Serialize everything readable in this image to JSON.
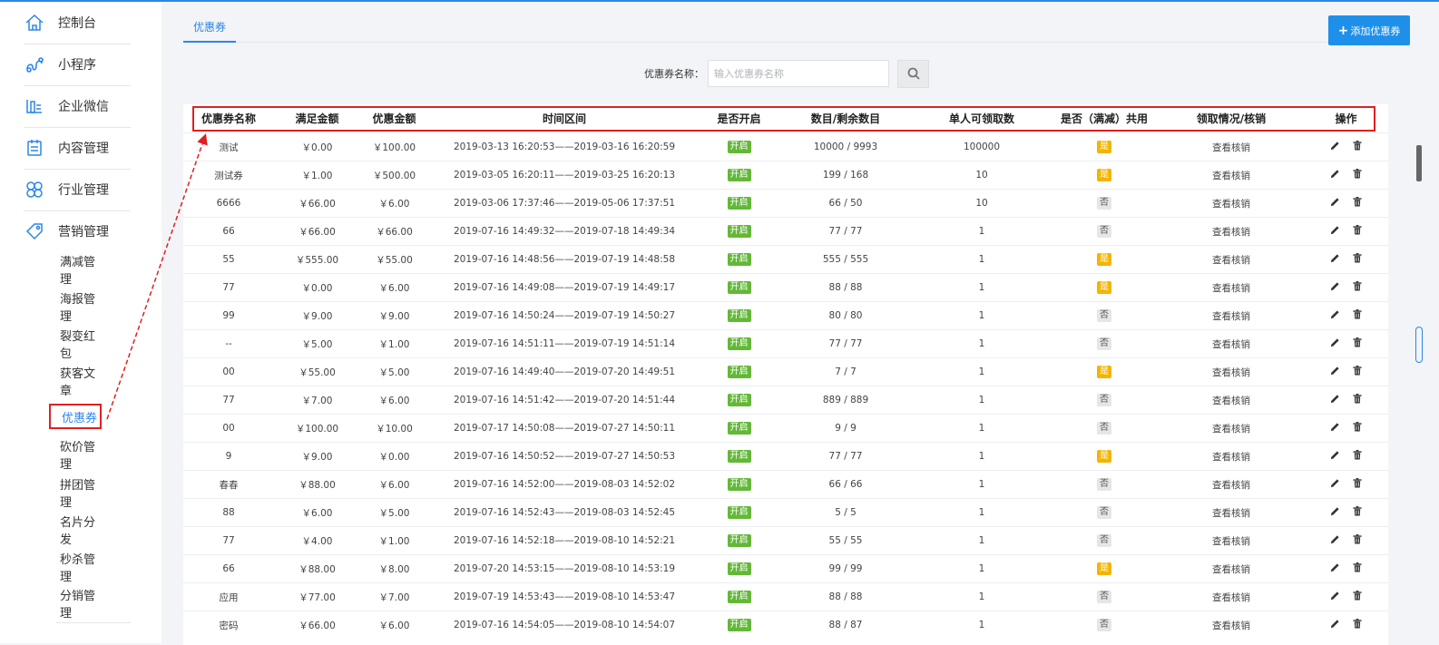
{
  "sidebar": {
    "main_items": [
      {
        "label": "控制台",
        "icon": "home-icon"
      },
      {
        "label": "小程序",
        "icon": "miniprogram-icon"
      },
      {
        "label": "企业微信",
        "icon": "wechat-work-icon"
      },
      {
        "label": "内容管理",
        "icon": "content-icon"
      },
      {
        "label": "行业管理",
        "icon": "industry-icon"
      },
      {
        "label": "营销管理",
        "icon": "tag-icon"
      }
    ],
    "sub_items": [
      "满减管理",
      "海报管理",
      "裂变红包",
      "获客文章",
      "优惠券",
      "砍价管理",
      "拼团管理",
      "名片分发",
      "秒杀管理",
      "分销管理"
    ],
    "active_sub": "优惠券"
  },
  "tabs": [
    {
      "label": "优惠券"
    }
  ],
  "add_button": {
    "label": "添加优惠券"
  },
  "search": {
    "label": "优惠券名称：",
    "placeholder": "输入优惠券名称"
  },
  "table": {
    "headers": [
      "优惠券名称",
      "满足金额",
      "优惠金额",
      "时间区间",
      "是否开启",
      "数目/剩余数目",
      "单人可领取数",
      "是否（满减）共用",
      "领取情况/核销",
      "操作"
    ],
    "rows": [
      {
        "name": "测试",
        "min": "￥0.00",
        "discount": "￥100.00",
        "period": "2019-03-13 16:20:53——2019-03-16 16:20:59",
        "enabled": "开启",
        "count": "10000 / 9993",
        "per_user": "100000",
        "shared": "是",
        "detail": "查看核销"
      },
      {
        "name": "测试券",
        "min": "￥1.00",
        "discount": "￥500.00",
        "period": "2019-03-05 16:20:11——2019-03-25 16:20:13",
        "enabled": "开启",
        "count": "199 / 168",
        "per_user": "10",
        "shared": "是",
        "detail": "查看核销"
      },
      {
        "name": "6666",
        "min": "￥66.00",
        "discount": "￥6.00",
        "period": "2019-03-06 17:37:46——2019-05-06 17:37:51",
        "enabled": "开启",
        "count": "66 / 50",
        "per_user": "10",
        "shared": "否",
        "detail": "查看核销"
      },
      {
        "name": "66",
        "min": "￥66.00",
        "discount": "￥66.00",
        "period": "2019-07-16 14:49:32——2019-07-18 14:49:34",
        "enabled": "开启",
        "count": "77 / 77",
        "per_user": "1",
        "shared": "否",
        "detail": "查看核销"
      },
      {
        "name": "55",
        "min": "￥555.00",
        "discount": "￥55.00",
        "period": "2019-07-16 14:48:56——2019-07-19 14:48:58",
        "enabled": "开启",
        "count": "555 / 555",
        "per_user": "1",
        "shared": "是",
        "detail": "查看核销"
      },
      {
        "name": "77",
        "min": "￥0.00",
        "discount": "￥6.00",
        "period": "2019-07-16 14:49:08——2019-07-19 14:49:17",
        "enabled": "开启",
        "count": "88 / 88",
        "per_user": "1",
        "shared": "是",
        "detail": "查看核销"
      },
      {
        "name": "99",
        "min": "￥9.00",
        "discount": "￥9.00",
        "period": "2019-07-16 14:50:24——2019-07-19 14:50:27",
        "enabled": "开启",
        "count": "80 / 80",
        "per_user": "1",
        "shared": "否",
        "detail": "查看核销"
      },
      {
        "name": "--",
        "min": "￥5.00",
        "discount": "￥1.00",
        "period": "2019-07-16 14:51:11——2019-07-19 14:51:14",
        "enabled": "开启",
        "count": "77 / 77",
        "per_user": "1",
        "shared": "否",
        "detail": "查看核销"
      },
      {
        "name": "00",
        "min": "￥55.00",
        "discount": "￥5.00",
        "period": "2019-07-16 14:49:40——2019-07-20 14:49:51",
        "enabled": "开启",
        "count": "7 / 7",
        "per_user": "1",
        "shared": "是",
        "detail": "查看核销"
      },
      {
        "name": "77",
        "min": "￥7.00",
        "discount": "￥6.00",
        "period": "2019-07-16 14:51:42——2019-07-20 14:51:44",
        "enabled": "开启",
        "count": "889 / 889",
        "per_user": "1",
        "shared": "否",
        "detail": "查看核销"
      },
      {
        "name": "00",
        "min": "￥100.00",
        "discount": "￥10.00",
        "period": "2019-07-17 14:50:08——2019-07-27 14:50:11",
        "enabled": "开启",
        "count": "9 / 9",
        "per_user": "1",
        "shared": "否",
        "detail": "查看核销"
      },
      {
        "name": "9",
        "min": "￥9.00",
        "discount": "￥0.00",
        "period": "2019-07-16 14:50:52——2019-07-27 14:50:53",
        "enabled": "开启",
        "count": "77 / 77",
        "per_user": "1",
        "shared": "是",
        "detail": "查看核销"
      },
      {
        "name": "春春",
        "min": "￥88.00",
        "discount": "￥6.00",
        "period": "2019-07-16 14:52:00——2019-08-03 14:52:02",
        "enabled": "开启",
        "count": "66 / 66",
        "per_user": "1",
        "shared": "否",
        "detail": "查看核销"
      },
      {
        "name": "88",
        "min": "￥6.00",
        "discount": "￥5.00",
        "period": "2019-07-16 14:52:43——2019-08-03 14:52:45",
        "enabled": "开启",
        "count": "5 / 5",
        "per_user": "1",
        "shared": "否",
        "detail": "查看核销"
      },
      {
        "name": "77",
        "min": "￥4.00",
        "discount": "￥1.00",
        "period": "2019-07-16 14:52:18——2019-08-10 14:52:21",
        "enabled": "开启",
        "count": "55 / 55",
        "per_user": "1",
        "shared": "否",
        "detail": "查看核销"
      },
      {
        "name": "66",
        "min": "￥88.00",
        "discount": "￥8.00",
        "period": "2019-07-20 14:53:15——2019-08-10 14:53:19",
        "enabled": "开启",
        "count": "99 / 99",
        "per_user": "1",
        "shared": "是",
        "detail": "查看核销"
      },
      {
        "name": "应用",
        "min": "￥77.00",
        "discount": "￥7.00",
        "period": "2019-07-19 14:53:43——2019-08-10 14:53:47",
        "enabled": "开启",
        "count": "88 / 88",
        "per_user": "1",
        "shared": "否",
        "detail": "查看核销"
      },
      {
        "name": "密码",
        "min": "￥66.00",
        "discount": "￥6.00",
        "period": "2019-07-16 14:54:05——2019-08-10 14:54:07",
        "enabled": "开启",
        "count": "88 / 87",
        "per_user": "1",
        "shared": "否",
        "detail": "查看核销"
      }
    ]
  },
  "colors": {
    "primary": "#2b86e8",
    "add_button": "#1e90ea",
    "on_badge": "#63b838",
    "yes_badge": "#f2b500",
    "no_badge": "#e6e6e6",
    "highlight": "#e02020"
  }
}
